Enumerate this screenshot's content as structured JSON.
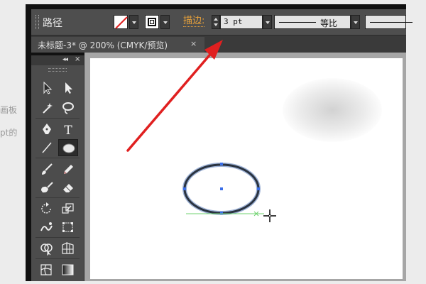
{
  "background": {
    "side_text_1": "画板",
    "side_text_2": "pt的"
  },
  "control_bar": {
    "selection_label": "路径",
    "stroke_label": "描边:",
    "stroke_weight": "3 pt",
    "profile_label": "等比"
  },
  "document_tab": {
    "title": "未标题-3* @ 200% (CMYK/预览)",
    "close_glyph": "×"
  },
  "tools_panel": {
    "collapse_glyph": "◂◂",
    "close_glyph": "×",
    "tools": [
      "selection",
      "direct-selection",
      "magic-wand",
      "lasso",
      "pen",
      "type",
      "line-segment",
      "ellipse",
      "paintbrush",
      "pencil",
      "blob-brush",
      "eraser",
      "rotate",
      "scale",
      "warp",
      "free-transform",
      "shape-builder",
      "perspective-grid",
      "mesh",
      "gradient"
    ],
    "selected_tool": "ellipse",
    "type_tool_glyph": "T"
  },
  "colors": {
    "annotation_arrow": "#e02020",
    "ellipse_stroke": "#2a3340",
    "anchor": "#3a6ee8",
    "smart_guide": "#6fd36f",
    "stroke_label": "#e8a13a"
  }
}
